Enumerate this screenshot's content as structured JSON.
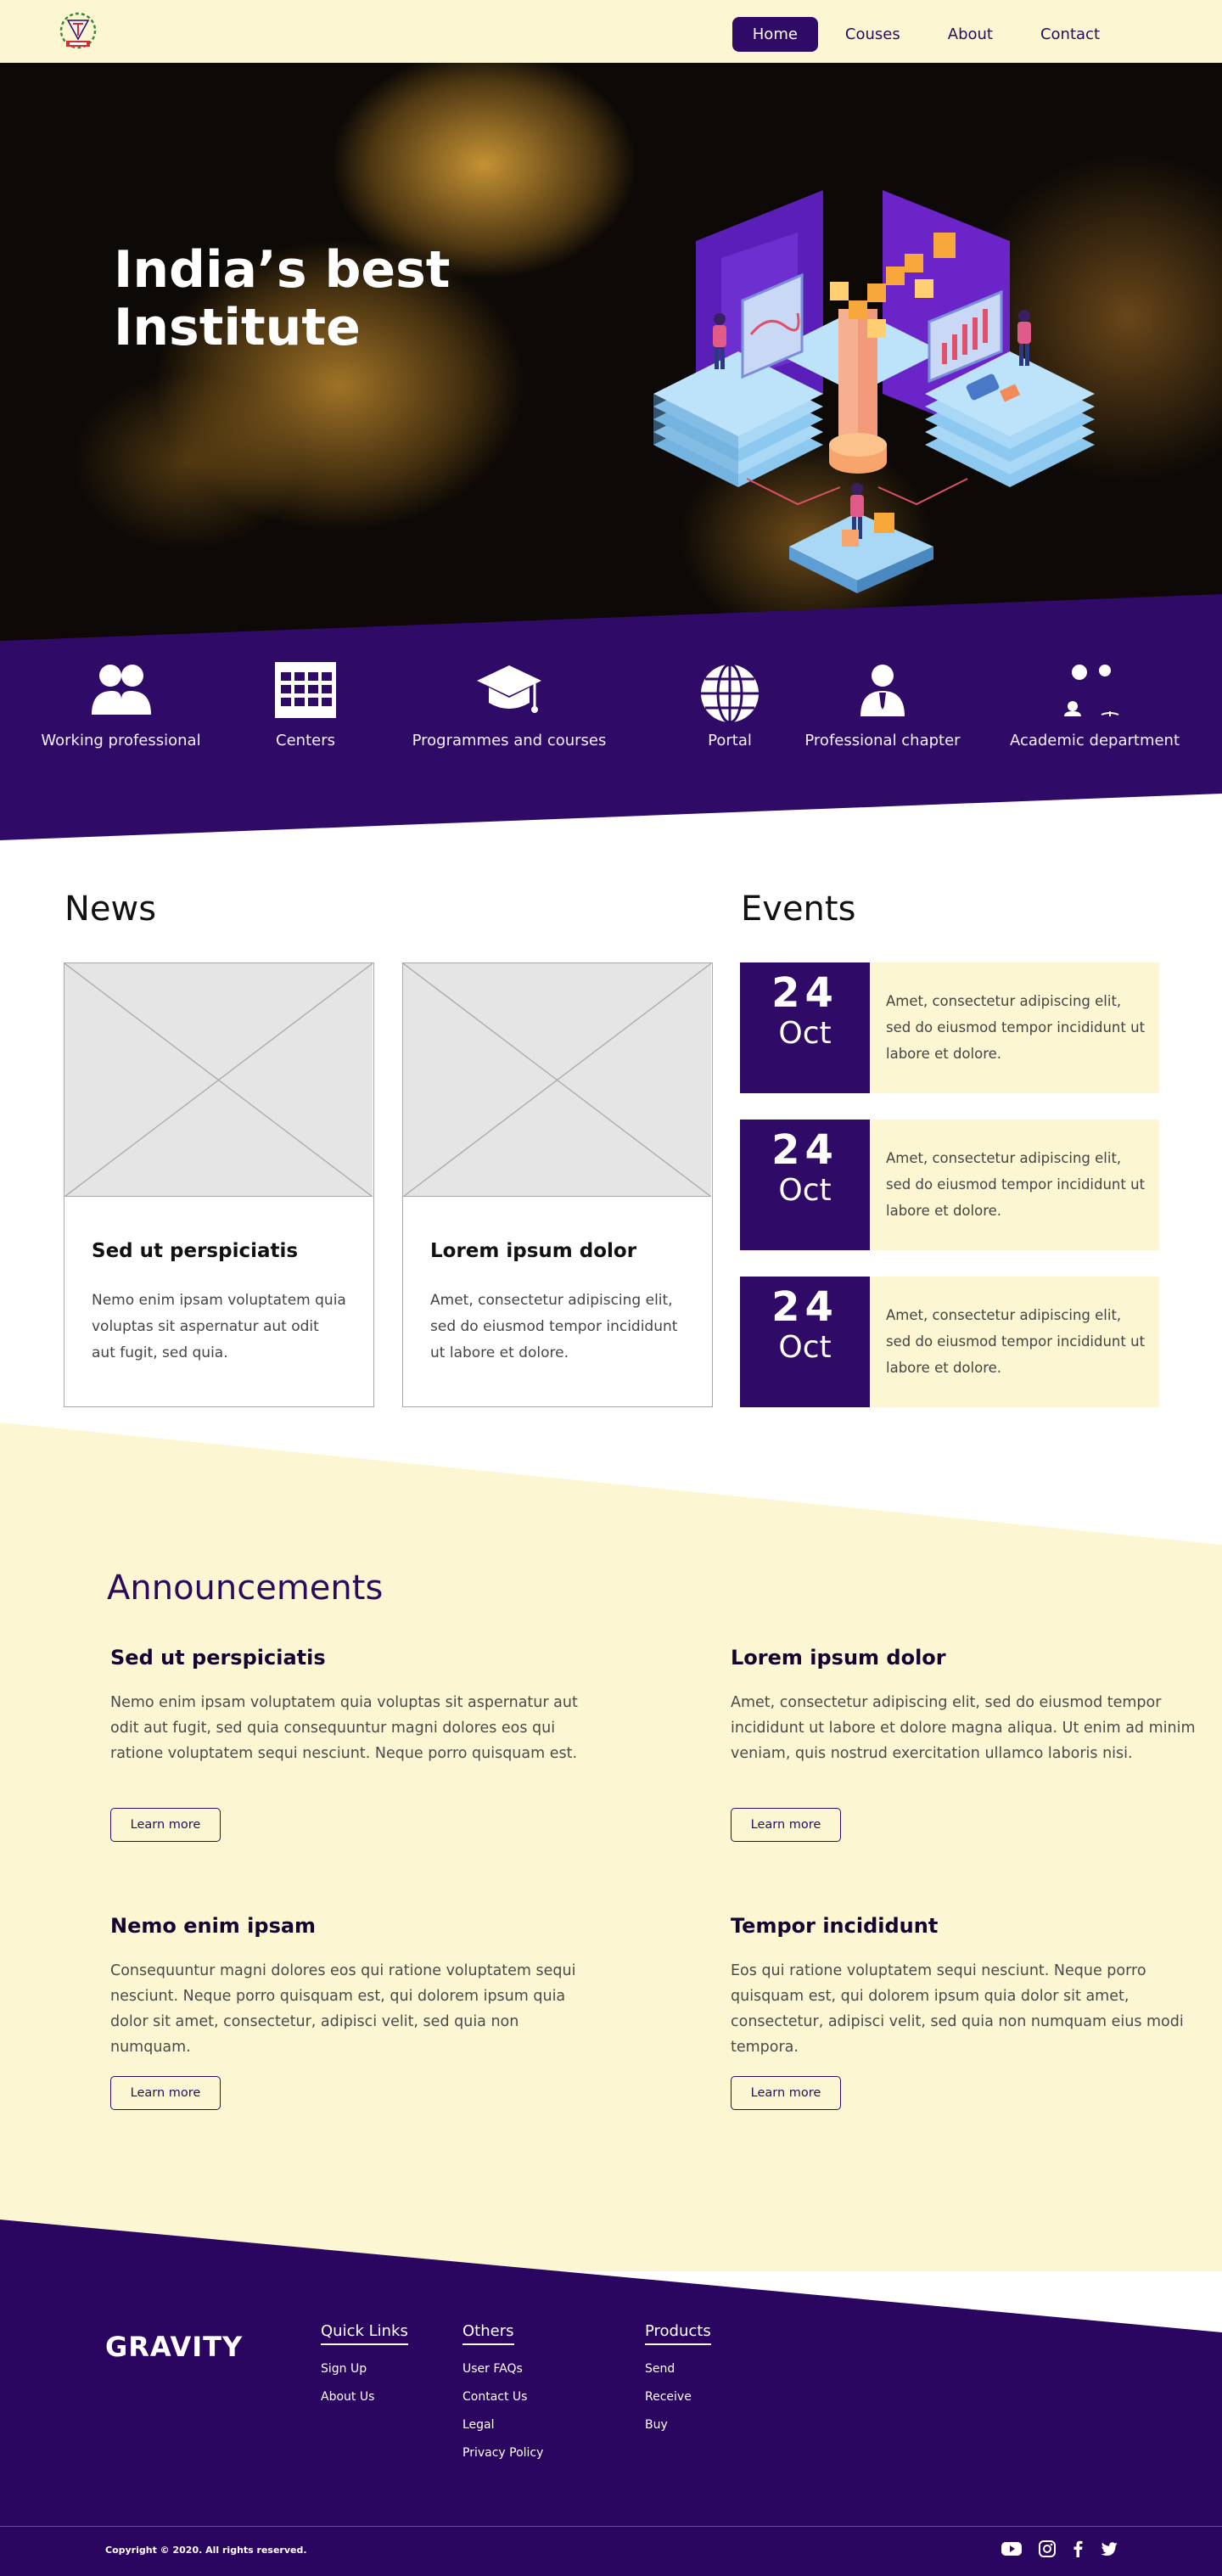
{
  "header": {
    "logo_icon": "institute-emblem-icon",
    "nav": [
      {
        "label": "Home",
        "active": true
      },
      {
        "label": "Couses",
        "active": false
      },
      {
        "label": "About",
        "active": false
      },
      {
        "label": "Contact",
        "active": false
      }
    ]
  },
  "hero": {
    "title": "India’s best\nInstitute",
    "illustration_icon": "isometric-data-center-illustration"
  },
  "categories": [
    {
      "label": "Working professional",
      "icon": "people-icon"
    },
    {
      "label": "Centers",
      "icon": "building-icon"
    },
    {
      "label": "Programmes and courses",
      "icon": "graduation-cap-icon"
    },
    {
      "label": "Portal",
      "icon": "globe-icon"
    },
    {
      "label": "Professional chapter",
      "icon": "businessman-icon"
    },
    {
      "label": "Academic department",
      "icon": "teaching-icon"
    }
  ],
  "news": {
    "title": "News",
    "items": [
      {
        "heading": "Sed ut perspiciatis",
        "text": "Nemo enim ipsam voluptatem quia voluptas sit aspernatur aut odit aut fugit, sed quia."
      },
      {
        "heading": "Lorem ipsum dolor",
        "text": "Amet, consectetur adipiscing elit, sed do eiusmod tempor incididunt ut labore et dolore."
      }
    ]
  },
  "events": {
    "title": "Events",
    "items": [
      {
        "day": "24",
        "month": "Oct",
        "text": "Amet, consectetur adipiscing elit, sed do eiusmod tempor incididunt ut labore et dolore."
      },
      {
        "day": "24",
        "month": "Oct",
        "text": "Amet, consectetur adipiscing elit, sed do eiusmod tempor incididunt ut labore et dolore."
      },
      {
        "day": "24",
        "month": "Oct",
        "text": "Amet, consectetur adipiscing elit, sed do eiusmod tempor incididunt ut labore et dolore."
      }
    ]
  },
  "announcements": {
    "title": "Announcements",
    "items": [
      {
        "heading": "Sed ut perspiciatis",
        "text": "Nemo enim ipsam voluptatem quia voluptas sit aspernatur aut odit aut fugit, sed quia consequuntur magni dolores eos qui ratione voluptatem sequi nesciunt. Neque porro quisquam est.",
        "button": "Learn more"
      },
      {
        "heading": "Lorem ipsum dolor",
        "text": "Amet, consectetur adipiscing elit, sed do eiusmod tempor incididunt ut labore et dolore magna aliqua. Ut enim ad minim veniam, quis nostrud exercitation ullamco laboris nisi.",
        "button": "Learn more"
      },
      {
        "heading": "Nemo enim ipsam",
        "text": "Consequuntur magni dolores eos qui ratione voluptatem sequi nesciunt. Neque porro quisquam est, qui dolorem ipsum quia dolor sit amet, consectetur, adipisci velit, sed quia non numquam.",
        "button": "Learn more"
      },
      {
        "heading": "Tempor incididunt",
        "text": "Eos qui ratione voluptatem sequi nesciunt. Neque porro quisquam est, qui dolorem ipsum quia dolor sit amet, consectetur, adipisci velit, sed quia non numquam eius modi tempora.",
        "button": "Learn more"
      }
    ]
  },
  "footer": {
    "brand": "GRAVITY",
    "columns": [
      {
        "title": "Quick Links",
        "links": [
          "Sign Up",
          "About Us"
        ]
      },
      {
        "title": "Others",
        "links": [
          "User FAQs",
          "Contact Us",
          "Legal",
          "Privacy Policy"
        ]
      },
      {
        "title": "Products",
        "links": [
          "Send",
          "Receive",
          "Buy"
        ]
      }
    ],
    "copyright": "Copyright © 2020. All rights reserved.",
    "social": [
      "youtube-icon",
      "instagram-icon",
      "facebook-icon",
      "twitter-icon"
    ]
  },
  "colors": {
    "accent": "#2f0a66",
    "cream": "#fdf6d2",
    "footer": "#2b0660"
  }
}
